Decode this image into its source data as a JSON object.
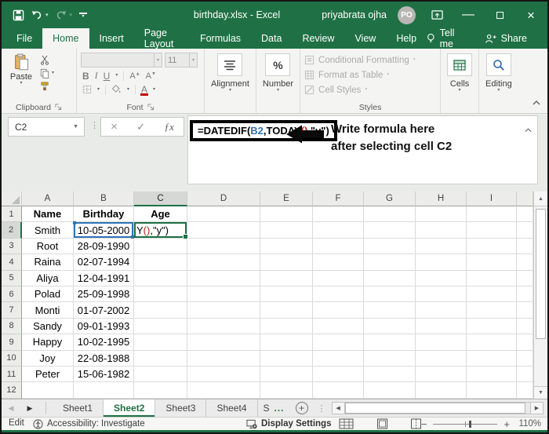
{
  "colors": {
    "accent_green": "#1e7145",
    "reference_blue": "#2e75b6",
    "paren_red": "#b02418"
  },
  "title_bar": {
    "title": "birthday.xlsx - Excel",
    "user_name": "priyabrata ojha",
    "user_initials": "PO"
  },
  "ribbon_tabs": {
    "labels": [
      "File",
      "Home",
      "Insert",
      "Page Layout",
      "Formulas",
      "Data",
      "Review",
      "View",
      "Help"
    ],
    "active": "Home",
    "tell_me": "Tell me",
    "share": "Share"
  },
  "ribbon": {
    "clipboard": {
      "label": "Clipboard",
      "paste": "Paste"
    },
    "font": {
      "label": "Font",
      "size": "11",
      "bold": "B",
      "italic": "I",
      "underline": "U",
      "grow": "A",
      "shrink": "A",
      "font_color": "A"
    },
    "alignment": {
      "label": "Alignment"
    },
    "number": {
      "label": "Number",
      "percent": "%"
    },
    "styles": {
      "label": "Styles",
      "items": [
        "Conditional Formatting",
        "Format as Table",
        "Cell Styles"
      ]
    },
    "cells": {
      "label": "Cells"
    },
    "editing": {
      "label": "Editing"
    }
  },
  "formula_bar": {
    "name_box": "C2",
    "fx_label": "ƒx",
    "segments": [
      {
        "t": "=DATEDIF(",
        "c": "#000000"
      },
      {
        "t": "B2",
        "c": "#2e75b6"
      },
      {
        "t": ",TODAY",
        "c": "#000000"
      },
      {
        "t": "()",
        "c": "#b02418"
      },
      {
        "t": ",\"y\")",
        "c": "#000000"
      }
    ],
    "annotation_line1": "Write formula here",
    "annotation_line2": "after selecting cell C2"
  },
  "sheet": {
    "columns": [
      "A",
      "B",
      "C",
      "D",
      "E",
      "F",
      "G",
      "H",
      "I"
    ],
    "selected_column": "C",
    "selected_row": "2",
    "active_cell_segments": [
      {
        "t": "Y",
        "c": "#000000"
      },
      {
        "t": "()",
        "c": "#b02418"
      },
      {
        "t": ",\"y\")",
        "c": "#000000"
      }
    ],
    "rows": [
      {
        "n": "1",
        "a": "Name",
        "b": "Birthday",
        "c": "Age"
      },
      {
        "n": "2",
        "a": "Smith",
        "b": "10-05-2000",
        "c": ""
      },
      {
        "n": "3",
        "a": "Root",
        "b": "28-09-1990",
        "c": ""
      },
      {
        "n": "4",
        "a": "Raina",
        "b": "02-07-1994",
        "c": ""
      },
      {
        "n": "5",
        "a": "Aliya",
        "b": "12-04-1991",
        "c": ""
      },
      {
        "n": "6",
        "a": "Polad",
        "b": "25-09-1998",
        "c": ""
      },
      {
        "n": "7",
        "a": "Monti",
        "b": "01-07-2002",
        "c": ""
      },
      {
        "n": "8",
        "a": "Sandy",
        "b": "09-01-1993",
        "c": ""
      },
      {
        "n": "9",
        "a": "Happy",
        "b": "10-02-1995",
        "c": ""
      },
      {
        "n": "10",
        "a": "Joy",
        "b": "22-08-1988",
        "c": ""
      },
      {
        "n": "11",
        "a": "Peter",
        "b": "15-06-1982",
        "c": ""
      },
      {
        "n": "12",
        "a": "",
        "b": "",
        "c": ""
      }
    ]
  },
  "sheet_tabs": {
    "tabs": [
      "Sheet1",
      "Sheet2",
      "Sheet3",
      "Sheet4"
    ],
    "active": "Sheet2",
    "partial": "S",
    "more": "..."
  },
  "status_bar": {
    "mode": "Edit",
    "accessibility": "Accessibility: Investigate",
    "display_settings": "Display Settings",
    "zoom": "110%"
  }
}
